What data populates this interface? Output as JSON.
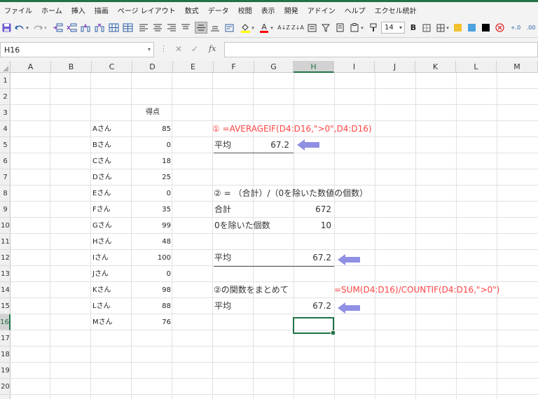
{
  "ribbon": {
    "tabs": [
      "ファイル",
      "ホーム",
      "挿入",
      "描画",
      "ページ レイアウト",
      "数式",
      "データ",
      "校閲",
      "表示",
      "開発",
      "アドイン",
      "ヘルプ",
      "エクセル統計"
    ]
  },
  "toolbar": {
    "font_size": "14",
    "bold_label": "B",
    "icons": [
      "save-icon",
      "undo-icon",
      "redo-icon",
      "align-icons",
      "fill-color-icon",
      "font-color-icon",
      "sort-icon",
      "filter-icon",
      "borders-icon",
      "cancel-icon"
    ],
    "accent": "#2e5fa8"
  },
  "formula_bar": {
    "name_box": "H16",
    "fx": "fx",
    "formula": ""
  },
  "grid": {
    "columns": [
      "A",
      "B",
      "C",
      "D",
      "E",
      "F",
      "G",
      "H",
      "I",
      "J",
      "K",
      "L",
      "M"
    ],
    "rows": [
      "1",
      "2",
      "3",
      "4",
      "5",
      "6",
      "7",
      "8",
      "9",
      "10",
      "11",
      "12",
      "13",
      "14",
      "15",
      "16",
      "17",
      "18",
      "19",
      "20"
    ],
    "active_column": "H",
    "active_row": "16",
    "accent": "#217346"
  },
  "table": {
    "header": "得点",
    "rows": [
      {
        "name": "Aさん",
        "score": "85"
      },
      {
        "name": "Bさん",
        "score": "0"
      },
      {
        "name": "Cさん",
        "score": "18"
      },
      {
        "name": "Dさん",
        "score": "25"
      },
      {
        "name": "Eさん",
        "score": "0"
      },
      {
        "name": "Fさん",
        "score": "35"
      },
      {
        "name": "Gさん",
        "score": "99"
      },
      {
        "name": "Hさん",
        "score": "48"
      },
      {
        "name": "Iさん",
        "score": "100"
      },
      {
        "name": "Jさん",
        "score": "0"
      },
      {
        "name": "Kさん",
        "score": "98"
      },
      {
        "name": "Lさん",
        "score": "88"
      },
      {
        "name": "Mさん",
        "score": "76"
      }
    ]
  },
  "method1": {
    "formula": "① =AVERAGEIF(D4:D16,\">0\",D4:D16)",
    "avg_label": "平均",
    "avg_value": "67.2"
  },
  "method2": {
    "title": "② = （合計）/（0を除いた数値の個数）",
    "sum_label": "合計",
    "sum_value": "672",
    "count_label": "0を除いた個数",
    "count_value": "10",
    "avg_label": "平均",
    "avg_value": "67.2"
  },
  "method3": {
    "title": "②の関数をまとめて",
    "formula": "=SUM(D4:D16)/COUNTIF(D4:D16,\">0\")",
    "avg_label": "平均",
    "avg_value": "67.2"
  },
  "colors": {
    "formula_text": "#ff4444",
    "arrow": "#8f8fe3"
  }
}
